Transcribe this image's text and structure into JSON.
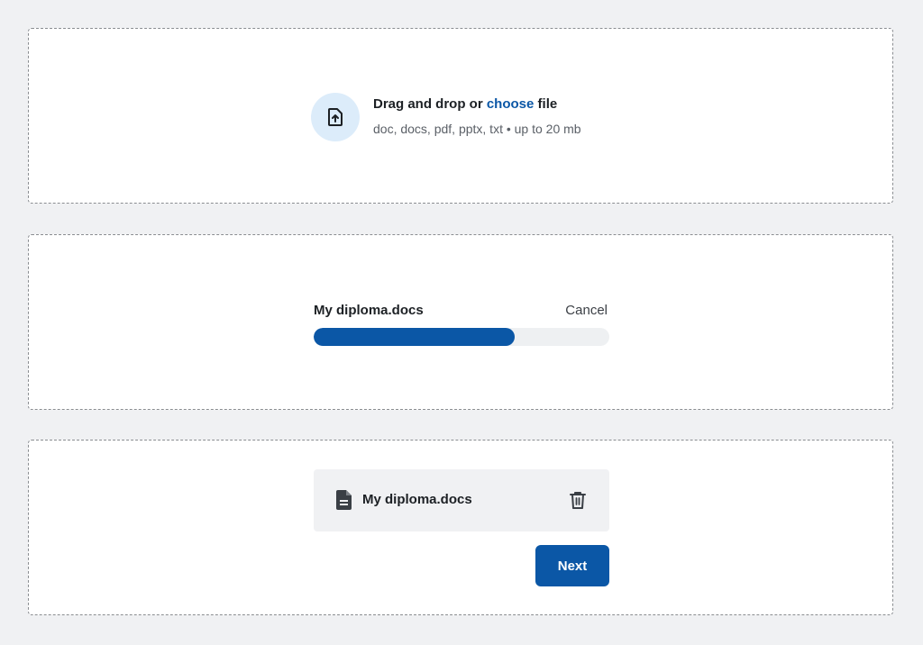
{
  "upload": {
    "title_prefix": "Drag and drop or ",
    "choose_link": "choose",
    "title_suffix": " file",
    "hint": "doc, docs, pdf, pptx, txt • up to 20 mb",
    "icon": "file-upload-icon"
  },
  "progress": {
    "file_name": "My diploma.docs",
    "cancel_label": "Cancel",
    "percent": 68
  },
  "uploaded": {
    "file_name": "My diploma.docs",
    "file_icon": "document-icon",
    "delete_icon": "trash-icon",
    "next_label": "Next"
  },
  "colors": {
    "accent": "#0b57a6",
    "icon_circle": "#dcecfa",
    "background": "#f0f1f3"
  }
}
